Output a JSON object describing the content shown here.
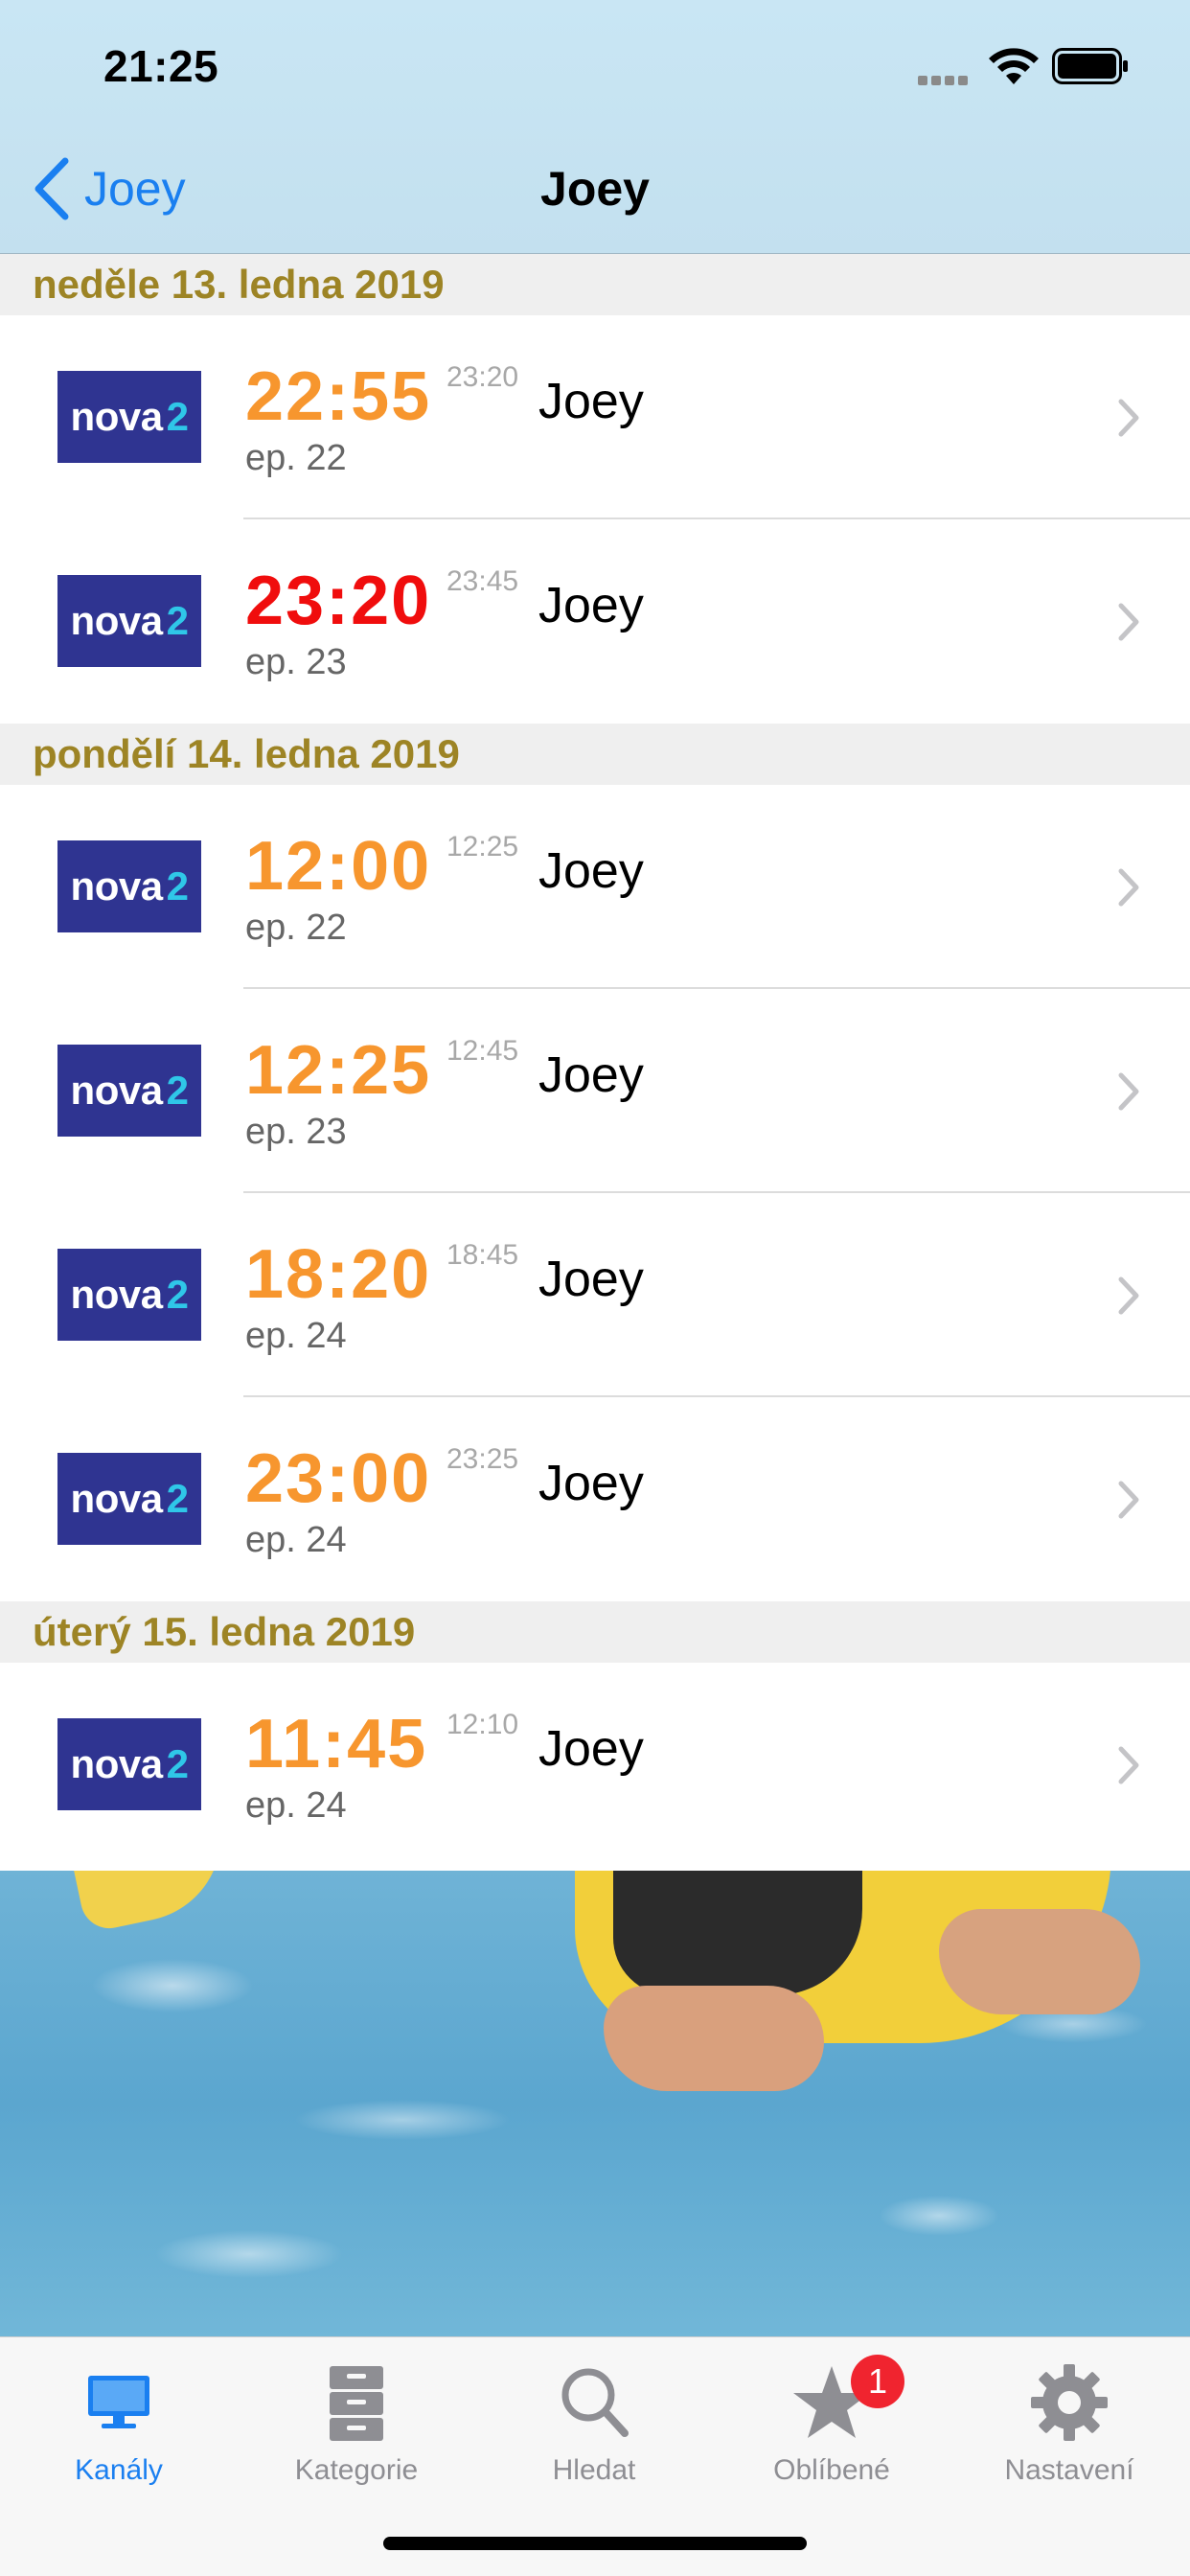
{
  "status_bar": {
    "time": "21:25"
  },
  "nav": {
    "back_label": "Joey",
    "title": "Joey"
  },
  "sections": [
    {
      "header": "neděle 13. ledna 2019",
      "rows": [
        {
          "channel": "nova",
          "channel_num": "2",
          "start": "22:55",
          "end": "23:20",
          "title": "Joey",
          "episode": "ep. 22",
          "start_color": "#f7962e"
        },
        {
          "channel": "nova",
          "channel_num": "2",
          "start": "23:20",
          "end": "23:45",
          "title": "Joey",
          "episode": "ep. 23",
          "start_color": "#f00d0d"
        }
      ]
    },
    {
      "header": "pondělí 14. ledna 2019",
      "rows": [
        {
          "channel": "nova",
          "channel_num": "2",
          "start": "12:00",
          "end": "12:25",
          "title": "Joey",
          "episode": "ep. 22",
          "start_color": "#f7962e"
        },
        {
          "channel": "nova",
          "channel_num": "2",
          "start": "12:25",
          "end": "12:45",
          "title": "Joey",
          "episode": "ep. 23",
          "start_color": "#f7962e"
        },
        {
          "channel": "nova",
          "channel_num": "2",
          "start": "18:20",
          "end": "18:45",
          "title": "Joey",
          "episode": "ep. 24",
          "start_color": "#f7962e"
        },
        {
          "channel": "nova",
          "channel_num": "2",
          "start": "23:00",
          "end": "23:25",
          "title": "Joey",
          "episode": "ep. 24",
          "start_color": "#f7962e"
        }
      ]
    },
    {
      "header": "úterý 15. ledna 2019",
      "rows": [
        {
          "channel": "nova",
          "channel_num": "2",
          "start": "11:45",
          "end": "12:10",
          "title": "Joey",
          "episode": "ep. 24",
          "start_color": "#f7962e"
        }
      ]
    }
  ],
  "tab_bar": {
    "tabs": [
      {
        "label": "Kanály",
        "icon": "monitor-icon",
        "active": true
      },
      {
        "label": "Kategorie",
        "icon": "cabinet-icon",
        "active": false
      },
      {
        "label": "Hledat",
        "icon": "search-icon",
        "active": false
      },
      {
        "label": "Oblíbené",
        "icon": "star-icon",
        "active": false,
        "badge": "1"
      },
      {
        "label": "Nastavení",
        "icon": "gear-icon",
        "active": false
      }
    ]
  },
  "colors": {
    "accent": "#1a7ff0",
    "section_header_text": "#9d8425",
    "start_time_orange": "#f7962e",
    "start_time_red": "#f00d0d",
    "channel_logo_bg": "#2f3491",
    "badge": "#f0242f"
  }
}
